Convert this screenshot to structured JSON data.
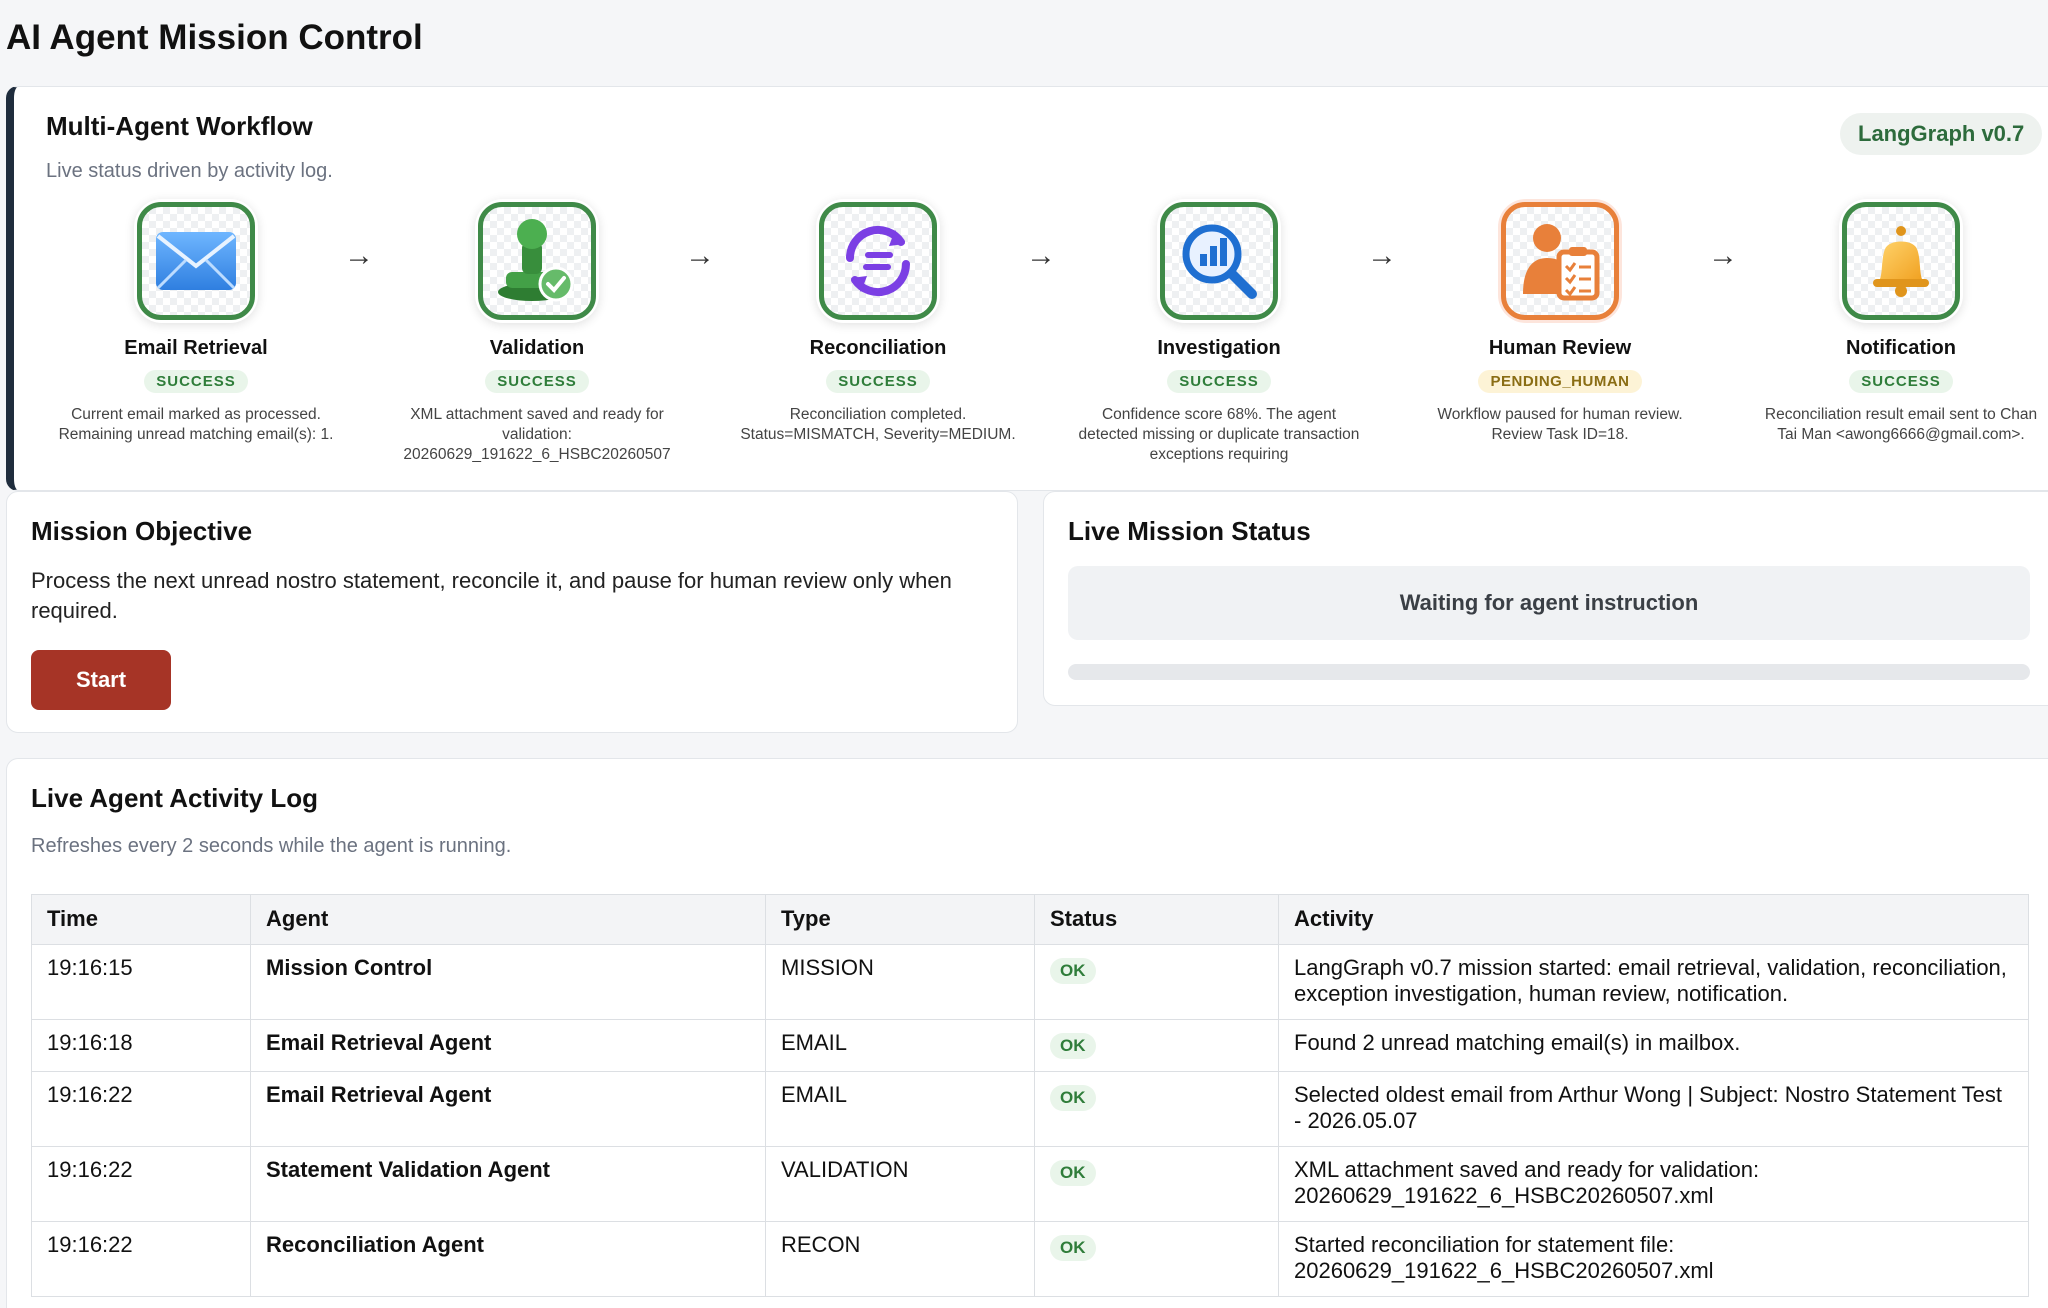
{
  "page": {
    "title": "AI Agent Mission Control"
  },
  "workflow": {
    "title": "Multi-Agent Workflow",
    "subtitle": "Live status driven by activity log.",
    "version_badge": "LangGraph v0.7",
    "arrow": "→",
    "nodes": [
      {
        "name": "Email Retrieval",
        "status": "SUCCESS",
        "icon": "envelope-icon",
        "description": "Current email marked as processed. Remaining unread matching email(s): 1."
      },
      {
        "name": "Validation",
        "status": "SUCCESS",
        "icon": "stamp-icon",
        "description": "XML attachment saved and ready for validation: 20260629_191622_6_HSBC20260507"
      },
      {
        "name": "Reconciliation",
        "status": "SUCCESS",
        "icon": "sync-icon",
        "description": "Reconciliation completed. Status=MISMATCH, Severity=MEDIUM."
      },
      {
        "name": "Investigation",
        "status": "SUCCESS",
        "icon": "chart-search-icon",
        "description": "Confidence score 68%. The agent detected missing or duplicate transaction exceptions requiring"
      },
      {
        "name": "Human Review",
        "status": "PENDING_HUMAN",
        "icon": "reviewer-icon",
        "description": "Workflow paused for human review. Review Task ID=18."
      },
      {
        "name": "Notification",
        "status": "SUCCESS",
        "icon": "bell-icon",
        "description": "Reconciliation result email sent to Chan Tai Man <awong6666@gmail.com>."
      }
    ],
    "colors": {
      "success": "#3f8a48",
      "pending": "#e8803a"
    }
  },
  "mission_objective": {
    "title": "Mission Objective",
    "text": "Process the next unread nostro statement, reconcile it, and pause for human review only when required.",
    "start_label": "Start"
  },
  "live_status": {
    "title": "Live Mission Status",
    "message": "Waiting for agent instruction",
    "progress": 0
  },
  "activity_log": {
    "title": "Live Agent Activity Log",
    "subtitle": "Refreshes every 2 seconds while the agent is running.",
    "columns": [
      "Time",
      "Agent",
      "Type",
      "Status",
      "Activity"
    ],
    "rows": [
      {
        "time": "19:16:15",
        "agent": "Mission Control",
        "type": "MISSION",
        "status": "OK",
        "activity": "LangGraph v0.7 mission started: email retrieval, validation, reconciliation, exception investigation, human review, notification."
      },
      {
        "time": "19:16:18",
        "agent": "Email Retrieval Agent",
        "type": "EMAIL",
        "status": "OK",
        "activity": "Found 2 unread matching email(s) in mailbox."
      },
      {
        "time": "19:16:22",
        "agent": "Email Retrieval Agent",
        "type": "EMAIL",
        "status": "OK",
        "activity": "Selected oldest email from Arthur Wong | Subject: Nostro Statement Test - 2026.05.07"
      },
      {
        "time": "19:16:22",
        "agent": "Statement Validation Agent",
        "type": "VALIDATION",
        "status": "OK",
        "activity": "XML attachment saved and ready for validation: 20260629_191622_6_HSBC20260507.xml"
      },
      {
        "time": "19:16:22",
        "agent": "Reconciliation Agent",
        "type": "RECON",
        "status": "OK",
        "activity": "Started reconciliation for statement file: 20260629_191622_6_HSBC20260507.xml"
      }
    ]
  }
}
